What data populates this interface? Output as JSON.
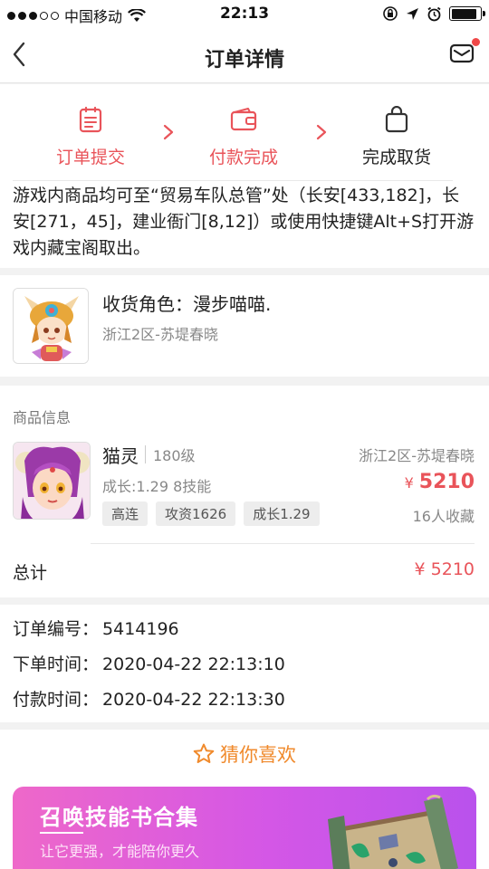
{
  "status_bar": {
    "carrier": "中国移动",
    "time": "22:13"
  },
  "header": {
    "title": "订单详情"
  },
  "steps": [
    {
      "label": "订单提交",
      "state": "active"
    },
    {
      "label": "付款完成",
      "state": "active"
    },
    {
      "label": "完成取货",
      "state": "pending"
    }
  ],
  "notice": "游戏内商品均可至“贸易车队总管”处（长安[433,182]，长安[271，45]，建业衙门[8,12]）或使用快捷键Alt+S打开游戏内藏宝阁取出。",
  "recipient": {
    "label": "收货角色：",
    "name": "漫步喵喵.",
    "server": "浙江2区-苏堤春晓"
  },
  "goods": {
    "section_title": "商品信息",
    "name": "猫灵",
    "level": "180级",
    "server": "浙江2区-苏堤春晓",
    "growth": "成长:1.29 8技能",
    "currency": "¥",
    "price": "5210",
    "tags": [
      "高连",
      "攻资1626",
      "成长1.29"
    ],
    "favorites": "16人收藏",
    "total_label": "总计",
    "total_value": "¥ 5210"
  },
  "order_info": {
    "order_no_label": "订单编号：",
    "order_no": "5414196",
    "created_label": "下单时间：",
    "created": "2020-04-22 22:13:10",
    "paid_label": "付款时间：",
    "paid": "2020-04-22 22:13:30"
  },
  "recommend": {
    "title": "猜你喜欢",
    "banner_title": "召唤技能书合集",
    "banner_subtitle": "让它更强，才能陪你更久"
  },
  "colors": {
    "accent": "#e9545a",
    "recommend": "#f08a2c",
    "banner_start": "#ee68c9",
    "banner_end": "#b952ec"
  }
}
